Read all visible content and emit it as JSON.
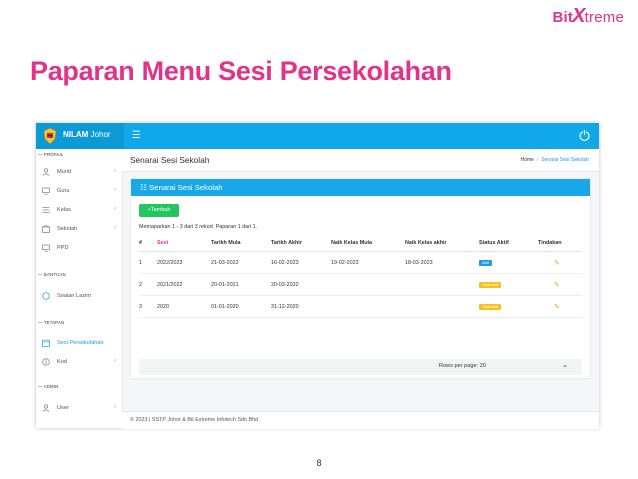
{
  "brand": {
    "part1": "Bit",
    "x": "X",
    "part2": "treme"
  },
  "slide": {
    "title": "Paparan Menu Sesi Persekolahan",
    "page_number": "8"
  },
  "app": {
    "title_bold": "NILAM",
    "title_rest": "Johor",
    "accent": "#10a8e8"
  },
  "sidebar": {
    "sections": {
      "profail": "PROFAIL",
      "bantuan": "BANTUAN",
      "tetapan": "TETAPAN",
      "admin": "ADMIN"
    },
    "items": [
      {
        "label": "Murid",
        "icon": "user-icon"
      },
      {
        "label": "Guru",
        "icon": "monitor-icon"
      },
      {
        "label": "Kelas",
        "icon": "list-icon"
      },
      {
        "label": "Sekolah",
        "icon": "building-icon"
      },
      {
        "label": "PPD",
        "icon": "monitor-icon"
      },
      {
        "label": "Soalan Lazim",
        "icon": "circle-icon"
      },
      {
        "label": "Sesi Persekolahan",
        "icon": "calendar-icon"
      },
      {
        "label": "Kod",
        "icon": "info-icon"
      },
      {
        "label": "User",
        "icon": "user-icon"
      }
    ]
  },
  "page": {
    "title": "Senarai Sesi Sekolah",
    "breadcrumb": {
      "home": "Home",
      "current": "Senarai Sesi Sekolah"
    }
  },
  "card": {
    "title": "Senarai Sesi Sekolah",
    "add_button": "Tambah",
    "summary": "Memaparkan 1 - 3 dari 3 rekod. Paparan 1 dari 1.",
    "columns": [
      "#",
      "Sesi",
      "Tarikh Mula",
      "Tarikh Akhir",
      "Naik Kelas Mula",
      "Naik Kelas akhir",
      "Status Aktif",
      "Tindakan"
    ],
    "rows": [
      {
        "no": "1",
        "sesi": "2022/2023",
        "mula": "21-03-2022",
        "akhir": "16-02-2023",
        "naik_mula": "19-02-2023",
        "naik_akhir": "18-03-2023",
        "status": "Aktif",
        "status_color": "#1e9be6"
      },
      {
        "no": "2",
        "sesi": "2021/2022",
        "mula": "20-01-2021",
        "akhir": "20-03-2022",
        "naik_mula": "",
        "naik_akhir": "",
        "status": "Tidak aktif",
        "status_color": "#f7c21b"
      },
      {
        "no": "3",
        "sesi": "2020",
        "mula": "01-01-2020",
        "akhir": "31-12-2020",
        "naik_mula": "",
        "naik_akhir": "",
        "status": "Tidak aktif",
        "status_color": "#f7c21b"
      }
    ],
    "rows_per_page": "Rows per page: 20"
  },
  "footer": {
    "text": "© 2023 | SSTP Johor & Bit Extreme Infotech Sdn Bhd"
  }
}
